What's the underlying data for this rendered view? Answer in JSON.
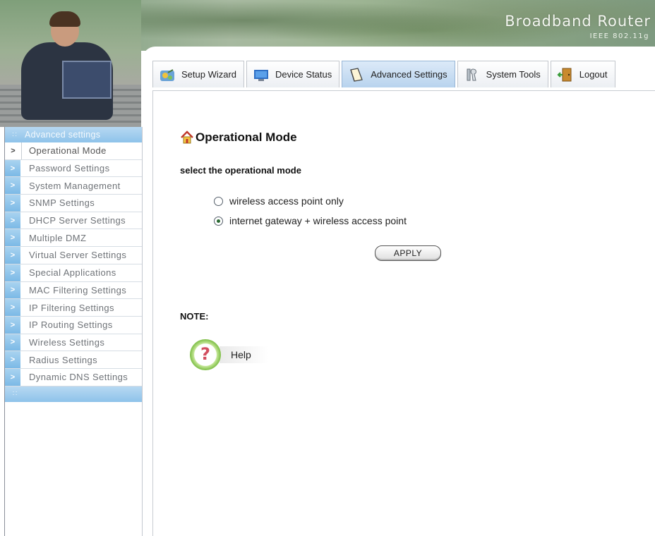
{
  "header": {
    "brand": "Broadband Router",
    "brand_sub": "IEEE 802.11g"
  },
  "tabs": [
    {
      "label": "Setup Wizard",
      "icon": "wizard-icon",
      "active": false
    },
    {
      "label": "Device Status",
      "icon": "monitor-icon",
      "active": false
    },
    {
      "label": "Advanced Settings",
      "icon": "notebook-icon",
      "active": true
    },
    {
      "label": "System Tools",
      "icon": "tools-icon",
      "active": false
    },
    {
      "label": "Logout",
      "icon": "door-exit-icon",
      "active": false
    }
  ],
  "sidebar": {
    "header": "Advanced settings",
    "items": [
      {
        "label": "Operational Mode",
        "current": true
      },
      {
        "label": "Password Settings"
      },
      {
        "label": "System Management"
      },
      {
        "label": "SNMP Settings"
      },
      {
        "label": "DHCP Server Settings"
      },
      {
        "label": "Multiple DMZ"
      },
      {
        "label": "Virtual Server Settings"
      },
      {
        "label": "Special Applications"
      },
      {
        "label": "MAC Filtering Settings"
      },
      {
        "label": "IP Filtering Settings"
      },
      {
        "label": "IP Routing Settings"
      },
      {
        "label": "Wireless Settings"
      },
      {
        "label": "Radius Settings"
      },
      {
        "label": "Dynamic DNS Settings"
      }
    ]
  },
  "main": {
    "title": "Operational Mode",
    "subtitle": "select the operational mode",
    "options": [
      {
        "label": "wireless access point only",
        "checked": false
      },
      {
        "label": "internet gateway + wireless access point",
        "checked": true
      }
    ],
    "apply_label": "APPLY",
    "note_label": "NOTE:",
    "help_label": "Help"
  },
  "colors": {
    "sidebar_accent": "#8ec3ea",
    "active_tab": "#b8d3ee",
    "help_ring": "#7fbf48",
    "help_question": "#d24e5f"
  }
}
